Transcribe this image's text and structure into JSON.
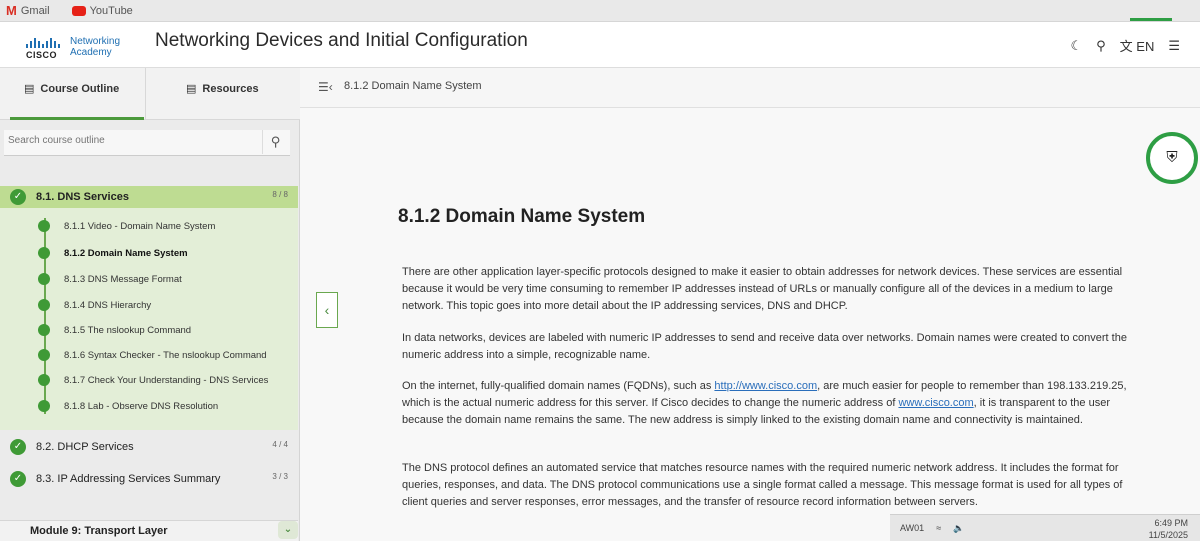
{
  "browser": {
    "bookmarks": [
      "Gmail",
      "YouTube"
    ]
  },
  "header": {
    "logo_top": "Networking",
    "logo_bottom": "Academy",
    "logo_brand": "CISCO",
    "course_title": "Networking Devices and Initial Configuration",
    "icons": [
      "moon-icon",
      "search-icon",
      "translate-icon",
      "menu-icon"
    ],
    "lang": "EN"
  },
  "sidebar": {
    "tabs": {
      "outline": "Course Outline",
      "resources": "Resources"
    },
    "search_placeholder": "Search course outline",
    "sections": [
      {
        "label": "8.1. DNS Services",
        "count": "8 / 8",
        "active": true
      },
      {
        "label": "8.2. DHCP Services",
        "count": "4 / 4",
        "active": false
      },
      {
        "label": "8.3. IP Addressing Services Summary",
        "count": "3 / 3",
        "active": false
      }
    ],
    "topics": [
      "8.1.1 Video - Domain Name System",
      "8.1.2 Domain Name System",
      "8.1.3 DNS Message Format",
      "8.1.4 DNS Hierarchy",
      "8.1.5 The nslookup Command",
      "8.1.6 Syntax Checker - The nslookup Command",
      "8.1.7 Check Your Understanding - DNS Services",
      "8.1.8 Lab - Observe DNS Resolution"
    ],
    "current_topic_index": 1,
    "next_module": "Module 9: Transport Layer"
  },
  "content": {
    "breadcrumb": "8.1.2 Domain Name System",
    "title": "8.1.2 Domain Name System",
    "p1": "There are other application layer-specific protocols designed to make it easier to obtain addresses for network devices. These services are essential because it would be very time consuming to remember IP addresses instead of URLs or manually configure all of the devices in a medium to large network. This topic goes into more detail about the IP addressing services, DNS and DHCP.",
    "p2": "In data networks, devices are labeled with numeric IP addresses to send and receive data over networks. Domain names were created to convert the numeric address into a simple, recognizable name.",
    "p3_a": "On the internet, fully-qualified domain names (FQDNs), such as ",
    "p3_link1": "http://www.cisco.com",
    "p3_b": ", are much easier for people to remember than 198.133.219.25, which is the actual numeric address for this server. If Cisco decides to change the numeric address of ",
    "p3_link2": "www.cisco.com",
    "p3_c": ", it is transparent to the user because the domain name remains the same. The new address is simply linked to the existing domain name and connectivity is maintained.",
    "p4": "The DNS protocol defines an automated service that matches resource names with the required numeric network address. It includes the format for queries, responses, and data. The DNS protocol communications use a single format called a message. This message format is used for all types of client queries and server responses, error messages, and the transfer of resource record information between servers."
  },
  "taskbar": {
    "label": "AW01",
    "time": "6:49 PM",
    "date": "11/5/2025"
  },
  "colors": {
    "accent": "#3f9a36",
    "active_section": "#bedc92",
    "link": "#2a6ebb"
  }
}
